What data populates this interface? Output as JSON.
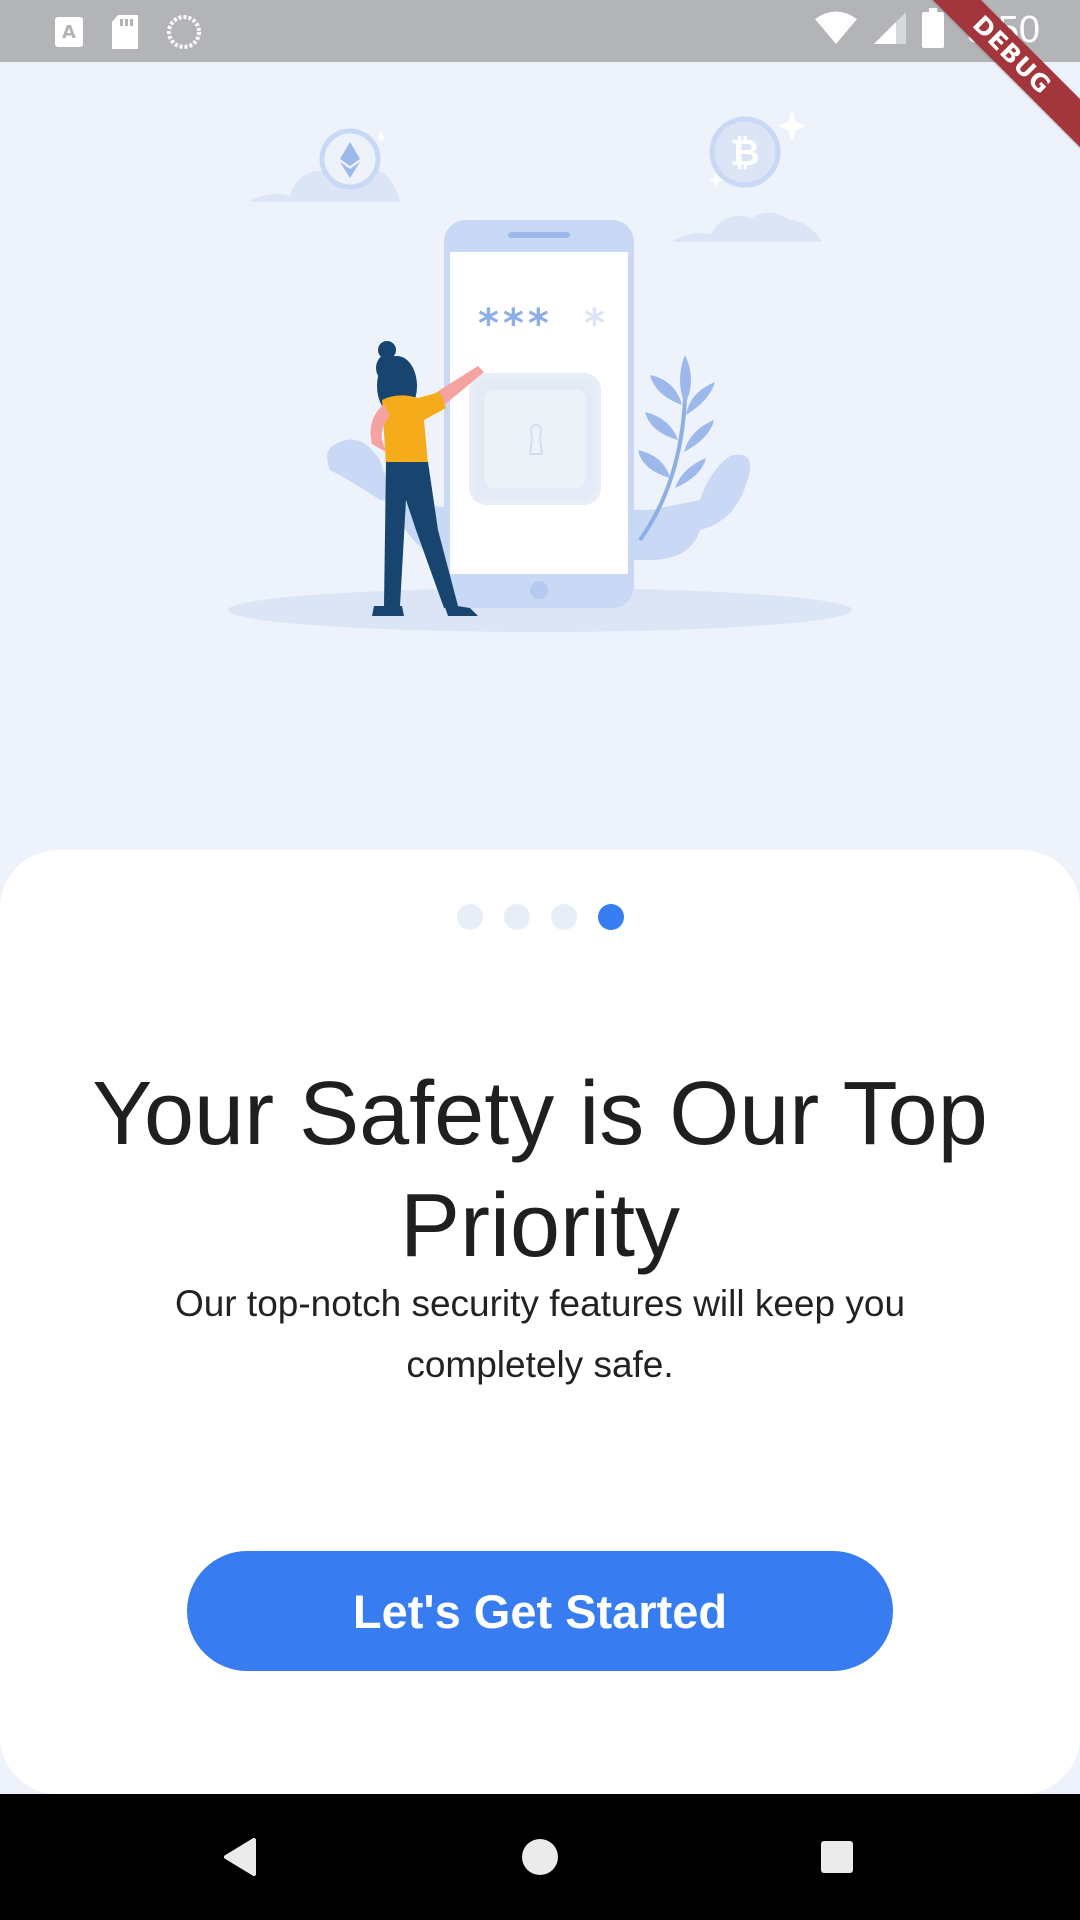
{
  "status_bar": {
    "time": "9:50",
    "left_icons": [
      "text-a-icon",
      "sd-card-icon",
      "sync-circle-icon"
    ],
    "right_icons": [
      "wifi-icon",
      "signal-icon",
      "battery-icon"
    ]
  },
  "debug_banner": {
    "label": "DEBUG"
  },
  "hero": {
    "illustration": "person-unlocking-phone-illustration",
    "password_mask": "* * * *",
    "coins": [
      "ethereum-coin-icon",
      "bitcoin-coin-icon"
    ]
  },
  "onboarding": {
    "page_indicator": {
      "count": 4,
      "active_index": 3
    },
    "title": "Your Safety is Our Top Priority",
    "subtitle": "Our top-notch security features will keep you completely safe.",
    "cta_label": "Let's Get Started"
  },
  "colors": {
    "accent": "#377cf0",
    "background": "#edf2fb",
    "illustration_light": "#c8d8f5",
    "figure_shirt": "#f5ab1a",
    "figure_pants": "#17456f"
  },
  "nav_bar": {
    "buttons": [
      "back-icon",
      "home-icon",
      "recents-icon"
    ]
  }
}
